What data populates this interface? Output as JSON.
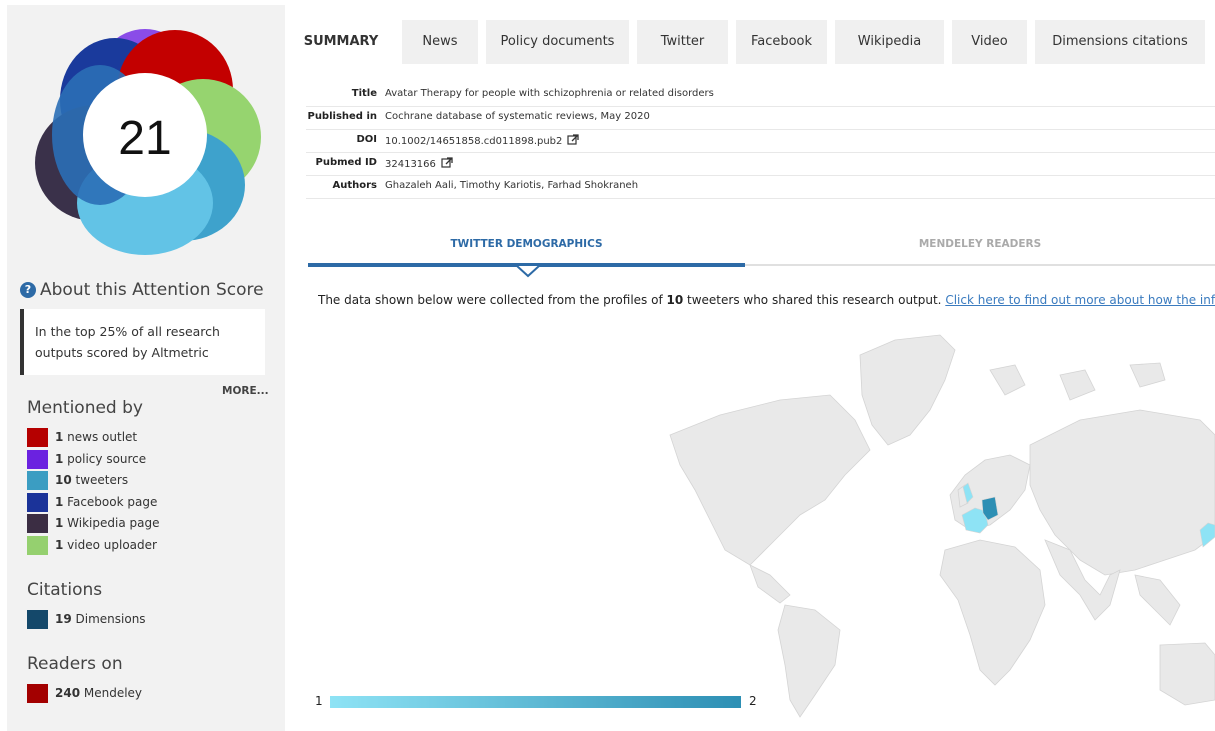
{
  "score": {
    "value": "21",
    "ring_colors": [
      "#8a4ce8",
      "#c30000",
      "#96d46f",
      "#3ea2cc",
      "#62c3e6",
      "#3a314a",
      "#1a3a9c",
      "#2b6fb6"
    ]
  },
  "about": {
    "title": "About this Attention Score",
    "card_text": "In the top 25% of all research outputs scored by Altmetric",
    "more_label": "MORE..."
  },
  "mentioned_by": {
    "title": "Mentioned by",
    "items": [
      {
        "count": "1",
        "label": "news outlet",
        "color": "#b50000"
      },
      {
        "count": "1",
        "label": "policy source",
        "color": "#6b22e0"
      },
      {
        "count": "10",
        "label": "tweeters",
        "color": "#3b9dc2"
      },
      {
        "count": "1",
        "label": "Facebook page",
        "color": "#1b3399"
      },
      {
        "count": "1",
        "label": "Wikipedia page",
        "color": "#3b2d43"
      },
      {
        "count": "1",
        "label": "video uploader",
        "color": "#95d06f"
      }
    ]
  },
  "citations": {
    "title": "Citations",
    "items": [
      {
        "count": "19",
        "label": "Dimensions",
        "color": "#14486a"
      }
    ]
  },
  "readers": {
    "title": "Readers on",
    "items": [
      {
        "count": "240",
        "label": "Mendeley",
        "color": "#a30000"
      }
    ]
  },
  "tabs": [
    "SUMMARY",
    "News",
    "Policy documents",
    "Twitter",
    "Facebook",
    "Wikipedia",
    "Video",
    "Dimensions citations"
  ],
  "meta": [
    {
      "key": "Title",
      "value": "Avatar Therapy for people with schizophrenia or related disorders"
    },
    {
      "key": "Published in",
      "value": "Cochrane database of systematic reviews, May 2020"
    },
    {
      "key": "DOI",
      "value": "10.1002/14651858.cd011898.pub2"
    },
    {
      "key": "Pubmed ID",
      "value": "32413166"
    },
    {
      "key": "Authors",
      "value": "Ghazaleh Aali, Timothy Kariotis, Farhad Shokraneh"
    }
  ],
  "subtabs": [
    "TWITTER DEMOGRAPHICS",
    "MENDELEY READERS"
  ],
  "description": {
    "prefix": "The data shown below were collected from the profiles of ",
    "count": "10",
    "suffix": " tweeters who shared this research output. ",
    "link": "Click here to find out more about how the information was compiled."
  },
  "map_legend": {
    "min": "1",
    "max": "2",
    "color_low": "#8ee3f5",
    "color_high": "#2d8fb4"
  }
}
